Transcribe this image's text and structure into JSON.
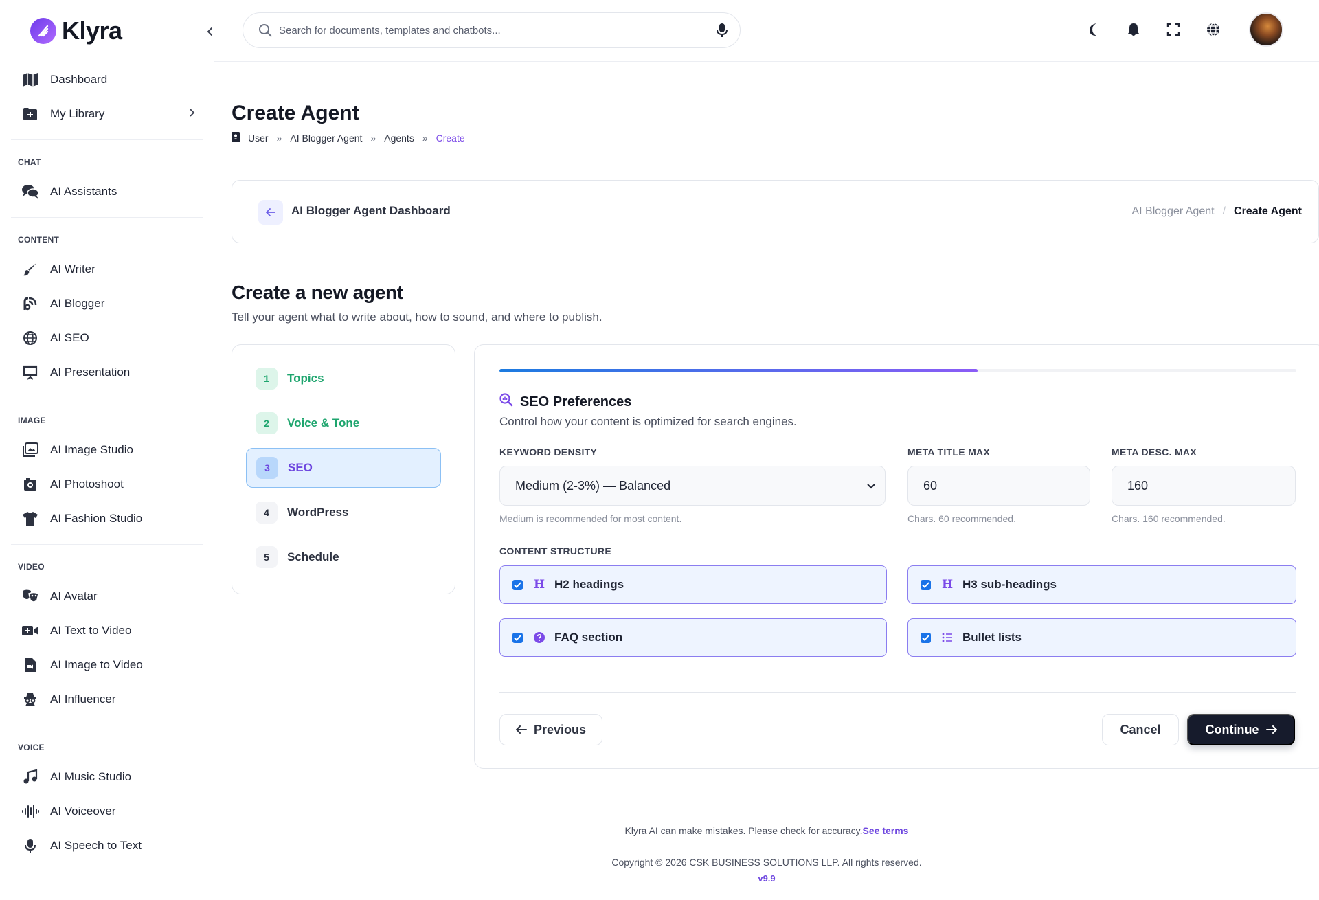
{
  "app": {
    "name": "Klyra"
  },
  "search": {
    "placeholder": "Search for documents, templates and chatbots..."
  },
  "sidebar": {
    "top_items": [
      {
        "label": "Dashboard",
        "icon": "map-icon"
      },
      {
        "label": "My Library",
        "icon": "folder-plus-icon"
      }
    ],
    "sections": [
      {
        "title": "CHAT",
        "items": [
          {
            "label": "AI Assistants",
            "icon": "chat-bubbles-icon"
          }
        ]
      },
      {
        "title": "CONTENT",
        "items": [
          {
            "label": "AI Writer",
            "icon": "brush-icon"
          },
          {
            "label": "AI Blogger",
            "icon": "blog-icon"
          },
          {
            "label": "AI SEO",
            "icon": "globe-icon"
          },
          {
            "label": "AI Presentation",
            "icon": "presentation-icon"
          }
        ]
      },
      {
        "title": "IMAGE",
        "items": [
          {
            "label": "AI Image Studio",
            "icon": "images-icon"
          },
          {
            "label": "AI Photoshoot",
            "icon": "camera-icon"
          },
          {
            "label": "AI Fashion Studio",
            "icon": "shirt-icon"
          }
        ]
      },
      {
        "title": "VIDEO",
        "items": [
          {
            "label": "AI Avatar",
            "icon": "masks-icon"
          },
          {
            "label": "AI Text to Video",
            "icon": "video-plus-icon"
          },
          {
            "label": "AI Image to Video",
            "icon": "file-video-icon"
          },
          {
            "label": "AI Influencer",
            "icon": "spy-icon"
          }
        ]
      },
      {
        "title": "VOICE",
        "items": [
          {
            "label": "AI Music Studio",
            "icon": "music-icon"
          },
          {
            "label": "AI Voiceover",
            "icon": "waveform-icon"
          },
          {
            "label": "AI Speech to Text",
            "icon": "microphone-icon"
          }
        ]
      }
    ]
  },
  "page": {
    "title": "Create Agent",
    "breadcrumb": [
      "User",
      "AI Blogger Agent",
      "Agents",
      "Create"
    ]
  },
  "subheader": {
    "title": "AI Blogger Agent Dashboard",
    "crumb_parent": "AI Blogger Agent",
    "crumb_current": "Create Agent"
  },
  "section": {
    "title": "Create a new agent",
    "subtitle": "Tell your agent what to write about, how to sound, and where to publish."
  },
  "steps": [
    {
      "num": "1",
      "label": "Topics",
      "state": "done"
    },
    {
      "num": "2",
      "label": "Voice & Tone",
      "state": "done"
    },
    {
      "num": "3",
      "label": "SEO",
      "state": "active"
    },
    {
      "num": "4",
      "label": "WordPress",
      "state": "todo"
    },
    {
      "num": "5",
      "label": "Schedule",
      "state": "todo"
    }
  ],
  "form": {
    "progress_fraction": 0.6,
    "title": "SEO Preferences",
    "subtitle": "Control how your content is optimized for search engines.",
    "keyword_density": {
      "label": "KEYWORD DENSITY",
      "value": "Medium (2-3%) — Balanced",
      "hint": "Medium is recommended for most content."
    },
    "meta_title_max": {
      "label": "META TITLE MAX",
      "value": "60",
      "hint": "Chars. 60 recommended."
    },
    "meta_desc_max": {
      "label": "META DESC. MAX",
      "value": "160",
      "hint": "Chars. 160 recommended."
    },
    "structure_label": "CONTENT STRUCTURE",
    "structure": [
      {
        "label": "H2 headings",
        "checked": true,
        "icon": "heading-icon"
      },
      {
        "label": "H3 sub-headings",
        "checked": true,
        "icon": "heading-icon"
      },
      {
        "label": "FAQ section",
        "checked": true,
        "icon": "question-circle-icon"
      },
      {
        "label": "Bullet lists",
        "checked": true,
        "icon": "list-icon"
      }
    ],
    "buttons": {
      "previous": "Previous",
      "cancel": "Cancel",
      "continue": "Continue"
    }
  },
  "footer": {
    "disclaimer": "Klyra AI can make mistakes. Please check for accuracy.",
    "terms": "See terms",
    "copyright": "Copyright © 2026 CSK BUSINESS SOLUTIONS LLP. All rights reserved.",
    "version": "v9.9"
  },
  "colors": {
    "accent": "#6d46df",
    "success": "#1ea56e",
    "primary_dark": "#161b2c",
    "checkbox": "#1a73e8"
  }
}
